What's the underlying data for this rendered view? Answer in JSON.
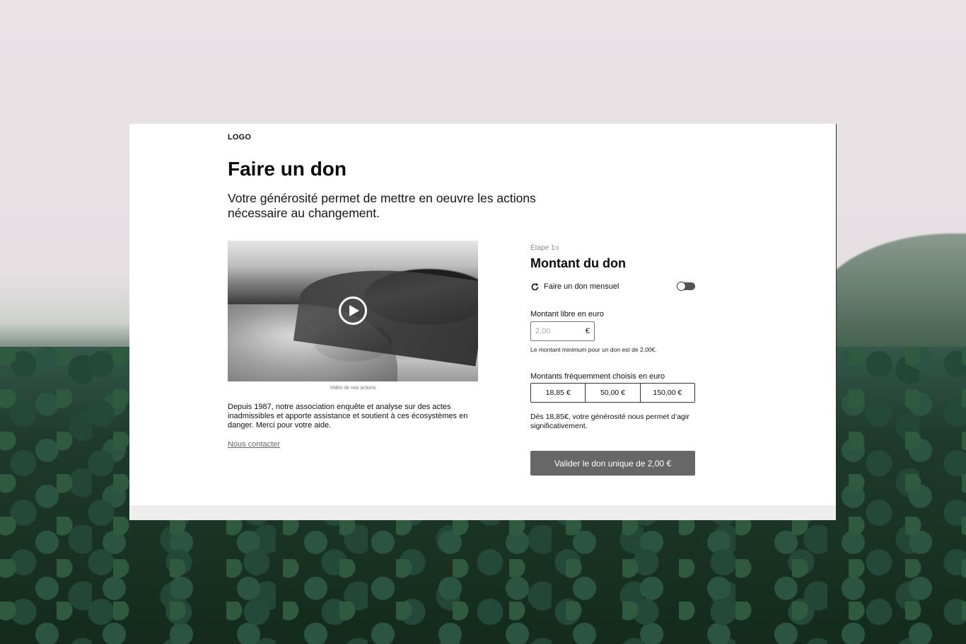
{
  "header": {
    "logo": "LOGO",
    "title": "Faire un don",
    "subtitle": "Votre générosité permet de mettre en oeuvre les actions nécessaire au changement."
  },
  "left": {
    "video_caption": "Vidéo de nos actions",
    "about": "Depuis 1987, notre association enquête et analyse sur des actes inadmissibles et apporte  assistance et soutient à ces écosystèmes en danger. Merci pour votre aide.",
    "contact_link": "Nous contacter"
  },
  "form": {
    "step_label": "Étape 1",
    "step_total": "/3",
    "title": "Montant du don",
    "monthly_label": "Faire un don mensuel",
    "monthly_enabled": false,
    "free_amount_label": "Montant libre en euro",
    "free_amount_placeholder": "2,00",
    "currency_symbol": "€",
    "min_hint": "Le montant minimum pour un don est de 2,00€.",
    "presets_label": "Montants fréquemment choisis en euro",
    "presets": [
      "18,85 €",
      "50,00 €",
      "150,00 €"
    ],
    "impact_text": "Dès 18,85€, votre générosité nous permet d’agir significativement.",
    "submit_label": "Valider le don unique de 2,00 €"
  },
  "colors": {
    "submit_bg": "#676767",
    "card_bg": "#ffffff",
    "footer_bg": "#eeeeee"
  }
}
